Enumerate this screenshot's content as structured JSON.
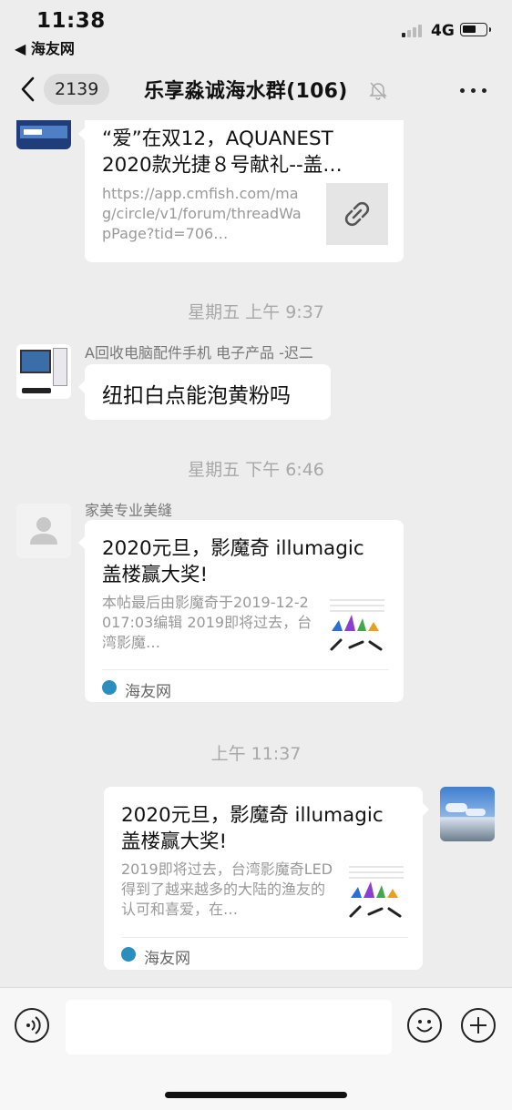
{
  "status_bar": {
    "time": "11:38",
    "back_app": "◀ 海友网",
    "network": "4G"
  },
  "header": {
    "unread_count": "2139",
    "title": "乐享淼诚海水群(106)"
  },
  "messages": [
    {
      "type": "link_card",
      "side": "left",
      "title": "“爱”在双12，AQUANEST 2020款光捷８号献礼--盖…",
      "url": "https://app.cmfish.com/mag/circle/v1/forum/threadWapPage?tid=706…"
    },
    {
      "type": "timestamp",
      "text": "星期五 上午 9:37"
    },
    {
      "type": "text",
      "side": "left",
      "sender": "A回收电脑配件手机 电子产品 -迟二",
      "text": "纽扣白点能泡黄粉吗"
    },
    {
      "type": "timestamp",
      "text": "星期五 下午 6:46"
    },
    {
      "type": "article_card",
      "side": "left",
      "sender": "家美专业美缝",
      "title": "2020元旦，影魔奇 illumagic 盖楼赢大奖!",
      "desc": "本帖最后由影魔奇于2019-12-2017:03编辑 2019即将过去，台湾影魔…",
      "source": "海友网"
    },
    {
      "type": "timestamp",
      "text": "上午 11:37"
    },
    {
      "type": "article_card",
      "side": "right",
      "title": "2020元旦，影魔奇 illumagic 盖楼赢大奖!",
      "desc": "2019即将过去，台湾影魔奇LED得到了越来越多的大陆的渔友的认可和喜爱，在…",
      "source": "海友网"
    }
  ],
  "input_bar": {
    "voice_icon": "voice-icon",
    "emoji_icon": "emoji-icon",
    "plus_icon": "plus-icon"
  },
  "colors": {
    "background": "#ededed",
    "bubble": "#ffffff",
    "timestamp": "#a8a8a8"
  }
}
